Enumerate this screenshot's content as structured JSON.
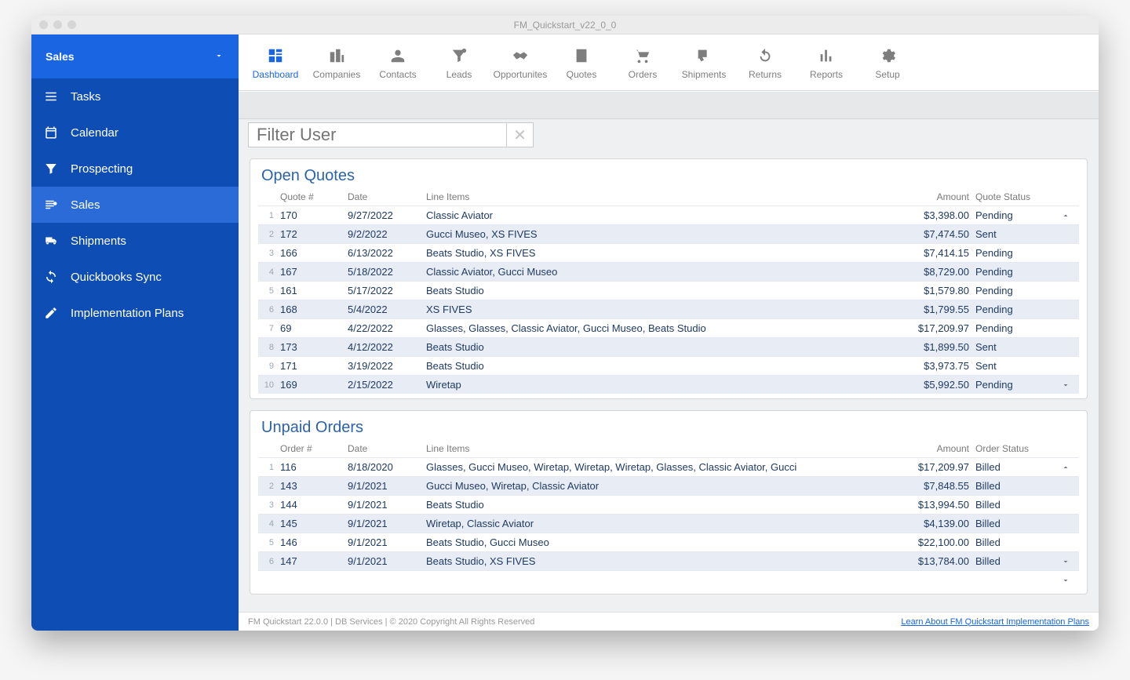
{
  "window_title": "FM_Quickstart_v22_0_0",
  "sidebar": {
    "header": {
      "label": "Sales"
    },
    "items": [
      {
        "label": "Tasks"
      },
      {
        "label": "Calendar"
      },
      {
        "label": "Prospecting"
      },
      {
        "label": "Sales"
      },
      {
        "label": "Shipments"
      },
      {
        "label": "Quickbooks Sync"
      },
      {
        "label": "Implementation Plans"
      }
    ]
  },
  "toolbar": {
    "items": [
      {
        "label": "Dashboard"
      },
      {
        "label": "Companies"
      },
      {
        "label": "Contacts"
      },
      {
        "label": "Leads"
      },
      {
        "label": "Opportunites"
      },
      {
        "label": "Quotes"
      },
      {
        "label": "Orders"
      },
      {
        "label": "Shipments"
      },
      {
        "label": "Returns"
      },
      {
        "label": "Reports"
      },
      {
        "label": "Setup"
      }
    ]
  },
  "filter": {
    "placeholder": "Filter User"
  },
  "quotes": {
    "title": "Open Quotes",
    "headers": {
      "id": "Quote #",
      "date": "Date",
      "items": "Line Items",
      "amount": "Amount",
      "status": "Quote Status"
    },
    "rows": [
      {
        "n": "1",
        "id": "170",
        "date": "9/27/2022",
        "items": "Classic Aviator",
        "amount": "$3,398.00",
        "status": "Pending"
      },
      {
        "n": "2",
        "id": "172",
        "date": "9/2/2022",
        "items": "Gucci Museo, XS FIVES",
        "amount": "$7,474.50",
        "status": "Sent"
      },
      {
        "n": "3",
        "id": "166",
        "date": "6/13/2022",
        "items": "Beats Studio, XS FIVES",
        "amount": "$7,414.15",
        "status": "Pending"
      },
      {
        "n": "4",
        "id": "167",
        "date": "5/18/2022",
        "items": "Classic Aviator, Gucci Museo",
        "amount": "$8,729.00",
        "status": "Pending"
      },
      {
        "n": "5",
        "id": "161",
        "date": "5/17/2022",
        "items": "Beats Studio",
        "amount": "$1,579.80",
        "status": "Pending"
      },
      {
        "n": "6",
        "id": "168",
        "date": "5/4/2022",
        "items": "XS FIVES",
        "amount": "$1,799.55",
        "status": "Pending"
      },
      {
        "n": "7",
        "id": "69",
        "date": "4/22/2022",
        "items": "Glasses, Glasses, Classic Aviator, Gucci Museo, Beats Studio",
        "amount": "$17,209.97",
        "status": "Pending"
      },
      {
        "n": "8",
        "id": "173",
        "date": "4/12/2022",
        "items": "Beats Studio",
        "amount": "$1,899.50",
        "status": "Sent"
      },
      {
        "n": "9",
        "id": "171",
        "date": "3/19/2022",
        "items": "Beats Studio",
        "amount": "$3,973.75",
        "status": "Sent"
      },
      {
        "n": "10",
        "id": "169",
        "date": "2/15/2022",
        "items": "Wiretap",
        "amount": "$5,992.50",
        "status": "Pending"
      }
    ]
  },
  "orders": {
    "title": "Unpaid Orders",
    "headers": {
      "id": "Order #",
      "date": "Date",
      "items": "Line Items",
      "amount": "Amount",
      "status": "Order Status"
    },
    "rows": [
      {
        "n": "1",
        "id": "116",
        "date": "8/18/2020",
        "items": "Glasses, Gucci Museo, Wiretap, Wiretap, Wiretap, Glasses, Classic Aviator, Gucci",
        "amount": "$17,209.97",
        "status": "Billed"
      },
      {
        "n": "2",
        "id": "143",
        "date": "9/1/2021",
        "items": "Gucci Museo, Wiretap, Classic Aviator",
        "amount": "$7,848.55",
        "status": "Billed"
      },
      {
        "n": "3",
        "id": "144",
        "date": "9/1/2021",
        "items": "Beats Studio",
        "amount": "$13,994.50",
        "status": "Billed"
      },
      {
        "n": "4",
        "id": "145",
        "date": "9/1/2021",
        "items": "Wiretap, Classic Aviator",
        "amount": "$4,139.00",
        "status": "Billed"
      },
      {
        "n": "5",
        "id": "146",
        "date": "9/1/2021",
        "items": "Beats Studio, Gucci Museo",
        "amount": "$22,100.00",
        "status": "Billed"
      },
      {
        "n": "6",
        "id": "147",
        "date": "9/1/2021",
        "items": "Beats Studio, XS FIVES",
        "amount": "$13,784.00",
        "status": "Billed"
      }
    ]
  },
  "footer": {
    "left": "FM Quickstart 22.0.0  | DB Services | © 2020 Copyright All Rights Reserved",
    "link": "Learn About FM Quickstart Implementation Plans"
  }
}
